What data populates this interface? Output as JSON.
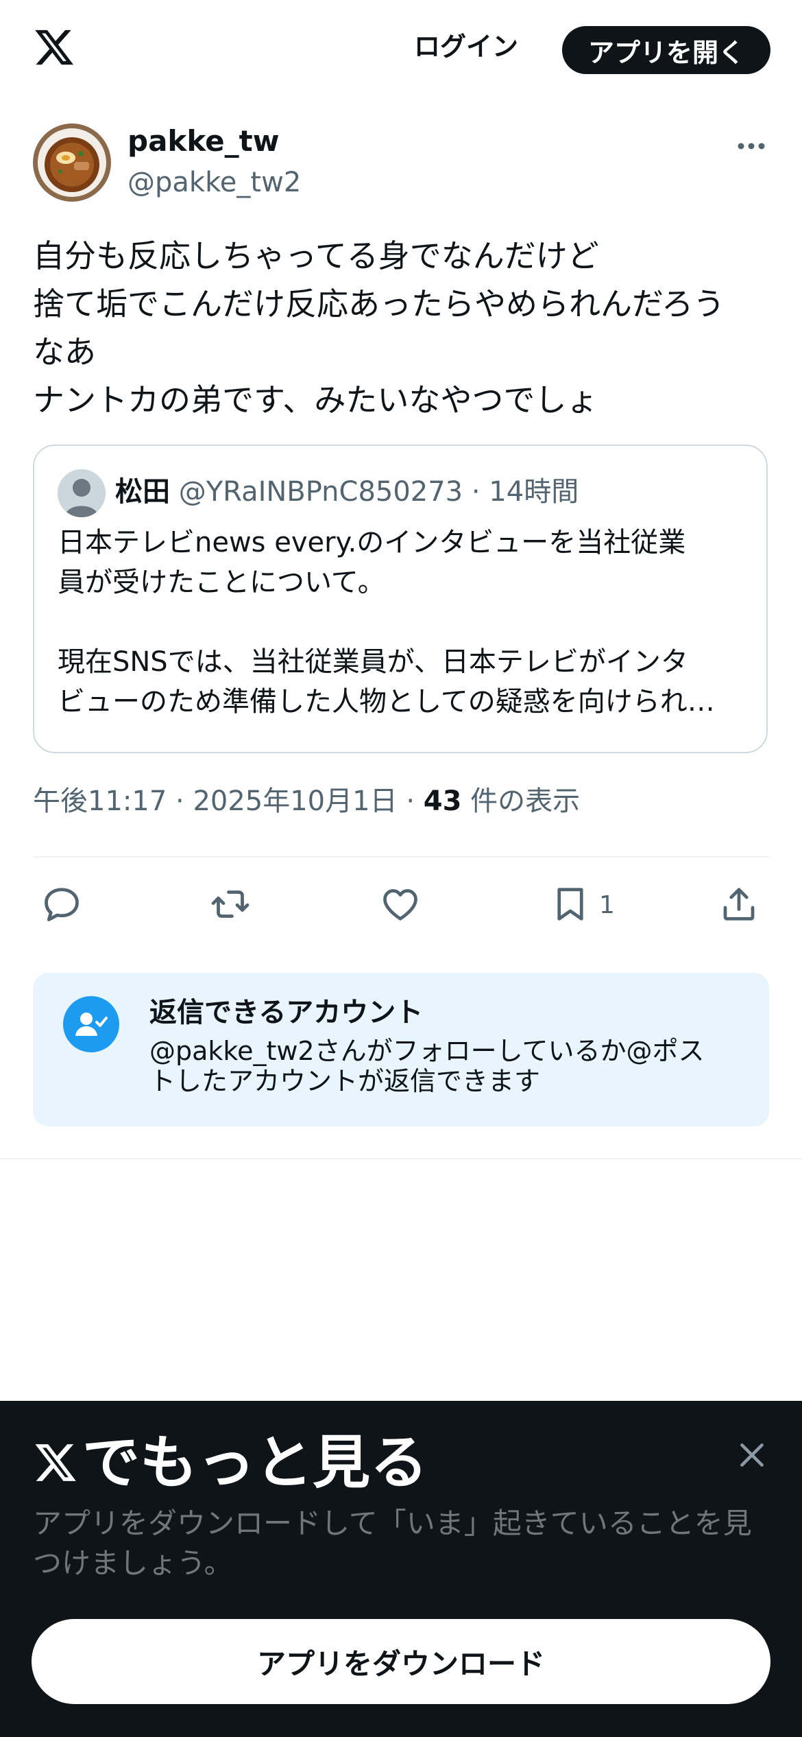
{
  "header": {
    "logo_icon": "x-logo-icon",
    "login_label": "ログイン",
    "open_app_label": "アプリを開く"
  },
  "post": {
    "author": {
      "name": "pakke_tw",
      "handle": "@pakke_tw2"
    },
    "more_icon": "more-dots-icon",
    "text": "自分も反応しちゃってる身でなんだけど\n捨て垢でこんだけ反応あったらやめられんだろう\nなあ\nナントカの弟です、みたいなやつでしょ",
    "quote": {
      "name": "松田",
      "handle": "@YRaINBPnC850273",
      "time": "14時間",
      "text": "日本テレビnews every.のインタビューを当社従業\n員が受けたことについて。\n\n現在SNSでは、当社従業員が、日本テレビがインタ\nビューのため準備した人物としての疑惑を向けられ…"
    },
    "meta": {
      "time": "午後11:17",
      "date": "2025年10月1日",
      "views_count": "43",
      "views_label": "件の表示"
    },
    "actions": {
      "reply_icon": "reply-icon",
      "repost_icon": "repost-icon",
      "like_icon": "heart-icon",
      "bookmark_icon": "bookmark-icon",
      "bookmark_count": "1",
      "share_icon": "share-icon"
    },
    "reply_restriction": {
      "title": "返信できるアカウント",
      "description": "@pakke_tw2さんがフォローしているか@ポス\nトしたアカウントが返信できます"
    }
  },
  "sheet": {
    "title": "でもっと見る",
    "description": "アプリをダウンロードして「いま」起きていることを見\nつけましょう。",
    "download_label": "アプリをダウンロード",
    "close_icon": "close-icon"
  },
  "colors": {
    "text": "#0f1419",
    "secondary": "#536471",
    "accent": "#1d9bf0",
    "reply_box_bg": "#e8f5fd",
    "sheet_bg": "#0f1419"
  }
}
